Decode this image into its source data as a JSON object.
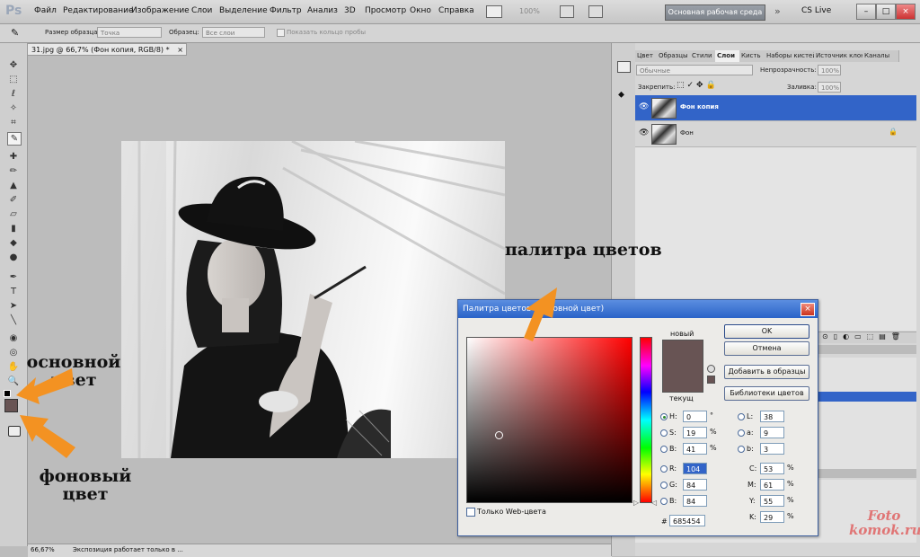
{
  "app": {
    "logo": "Ps"
  },
  "menu": [
    "Файл",
    "Редактирование",
    "Изображение",
    "Слои",
    "Выделение",
    "Фильтр",
    "Анализ",
    "3D",
    "Просмотр",
    "Окно",
    "Справка"
  ],
  "topbar": {
    "zoom": "100%",
    "workspace": "Основная рабочая среда",
    "cslive": "CS Live"
  },
  "options": {
    "sample_size_label": "Размер образца:",
    "sample_size_value": "Точка",
    "sample_label": "Образец:",
    "sample_value": "Все слои",
    "show_ring": "Показать кольцо пробы"
  },
  "document": {
    "tab": "31.jpg @ 66,7% (Фон копия, RGB/8) *",
    "close": "×"
  },
  "status": {
    "zoom": "66,67%",
    "info": "Экспозиция работает только в ..."
  },
  "panels": {
    "tabs": [
      "Цвет",
      "Образцы",
      "Стили",
      "Слои",
      "Кисть",
      "Наборы кистей",
      "Источник клонов",
      "Каналы"
    ],
    "active_tab": "Слои",
    "blend_mode": "Обычные",
    "opacity_label": "Непрозрачность:",
    "opacity_value": "100%",
    "lock_label": "Закрепить:",
    "fill_label": "Заливка:",
    "fill_value": "100%",
    "layers": [
      {
        "name": "Фон копия",
        "selected": true
      },
      {
        "name": "Фон",
        "selected": false
      }
    ]
  },
  "dialog": {
    "title": "Палитра цветов (Основной цвет)",
    "new_label": "новый",
    "current_label": "текущ",
    "new_color": "#685454",
    "current_color": "#685454",
    "ok": "OK",
    "cancel": "Отмена",
    "add_swatch": "Добавить в образцы",
    "libraries": "Библиотеки цветов",
    "web_only": "Только Web-цвета",
    "hsb": {
      "H": "0",
      "S": "19",
      "B": "41"
    },
    "rgb": {
      "R": "104",
      "G": "84",
      "B": "84"
    },
    "lab": {
      "L": "38",
      "a": "9",
      "b": "3"
    },
    "cmyk": {
      "C": "53",
      "M": "61",
      "Y": "55",
      "K": "29"
    },
    "hex_label": "#",
    "hex": "685454",
    "selected_mode": "H"
  },
  "annotations": {
    "palette": "палитра цветов",
    "foreground": "основной цвет",
    "background": "фоновый цвет"
  },
  "watermark": {
    "line1": "Foto",
    "line2": "komok.ru"
  },
  "colors": {
    "foreground_swatch": "#685454",
    "arrow": "#f39222",
    "selection": "#3264c8"
  }
}
